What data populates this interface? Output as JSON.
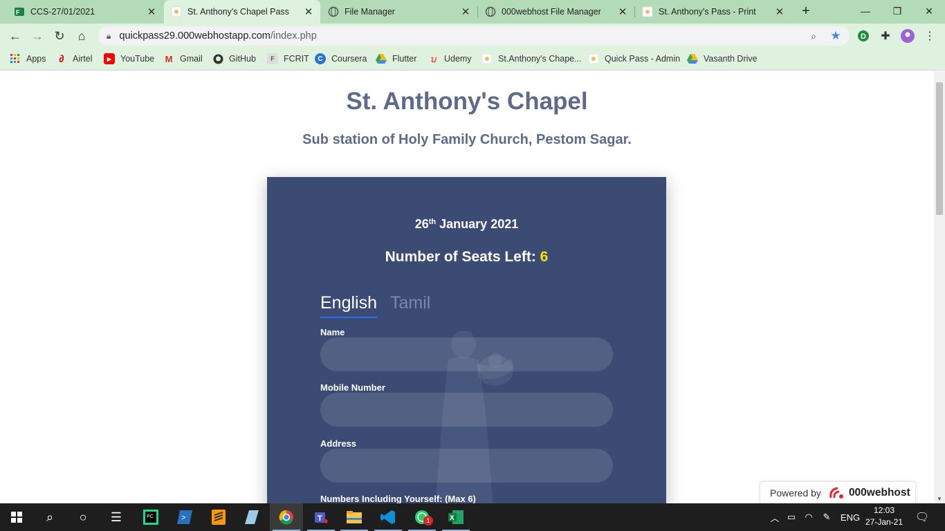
{
  "browser": {
    "tabs": [
      {
        "title": "CCS-27/01/2021",
        "active": false,
        "icon": "forms-icon"
      },
      {
        "title": "St. Anthony's Chapel Pass",
        "active": true,
        "icon": "chapel-favicon-icon"
      },
      {
        "title": "File Manager",
        "active": false,
        "icon": "globe-icon"
      },
      {
        "title": "000webhost File Manager",
        "active": false,
        "icon": "globe-icon"
      },
      {
        "title": "St. Anthony's Pass - Print",
        "active": false,
        "icon": "chapel-favicon-icon"
      }
    ],
    "url_host": "quickpass29.000webhostapp.com",
    "url_path": "/index.php",
    "bookmarks": [
      {
        "label": "Apps",
        "icon": "apps-grid-icon"
      },
      {
        "label": "Airtel",
        "icon": "airtel-icon"
      },
      {
        "label": "YouTube",
        "icon": "youtube-icon"
      },
      {
        "label": "Gmail",
        "icon": "gmail-icon"
      },
      {
        "label": "GitHub",
        "icon": "github-icon"
      },
      {
        "label": "FCRIT",
        "icon": "fcrit-icon"
      },
      {
        "label": "Coursera",
        "icon": "coursera-icon"
      },
      {
        "label": "Flutter",
        "icon": "drive-icon"
      },
      {
        "label": "Udemy",
        "icon": "udemy-icon"
      },
      {
        "label": "St.Anthony's Chape...",
        "icon": "chapel-favicon-icon"
      },
      {
        "label": "Quick Pass - Admin",
        "icon": "chapel-favicon-icon"
      },
      {
        "label": "Vasanth Drive",
        "icon": "drive-icon"
      }
    ]
  },
  "page": {
    "title": "St. Anthony's Chapel",
    "subtitle": "Sub station of Holy Family Church, Pestom Sagar.",
    "date_day": "26",
    "date_suffix": "th",
    "date_rest": " January 2021",
    "seats_label": "Number of Seats Left: ",
    "seats_value": "6",
    "lang_tabs": {
      "english": "English",
      "tamil": "Tamil"
    },
    "fields": {
      "name_label": "Name",
      "mobile_label": "Mobile Number",
      "address_label": "Address",
      "numbers_label": "Numbers Including Yourself: (Max 6)"
    },
    "powered_by": "Powered by",
    "powered_brand": "000webhost"
  },
  "taskbar": {
    "language": "ENG",
    "time": "12:03",
    "date": "27-Jan-21",
    "whatsapp_badge": "1"
  },
  "colors": {
    "tabbar": "#b4dbb7",
    "toolbar": "#dff1df",
    "card": "#3b4b74",
    "heading": "#5f6a8a",
    "seats_highlight": "#f4e500",
    "active_tab_underline": "#2a6cf0"
  }
}
